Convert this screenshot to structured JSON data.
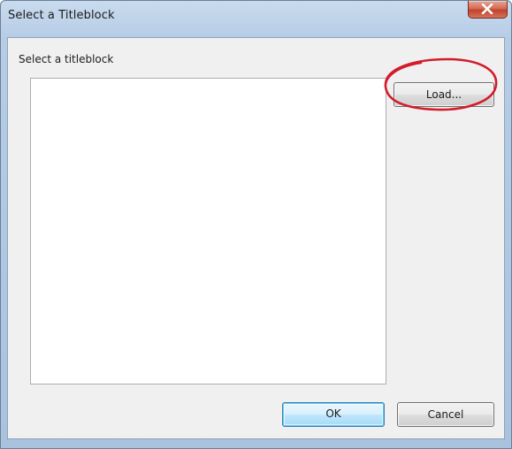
{
  "window": {
    "title": "Select a Titleblock"
  },
  "dialog": {
    "prompt": "Select a titleblock",
    "load_label": "Load...",
    "ok_label": "OK",
    "cancel_label": "Cancel",
    "titleblock_items": []
  },
  "icons": {
    "close": "close-icon"
  },
  "colors": {
    "annotation": "#d21c2a",
    "close_button": "#c9503a",
    "dialog_background": "#f0f0f0",
    "default_button_border": "#3c7fb1"
  }
}
